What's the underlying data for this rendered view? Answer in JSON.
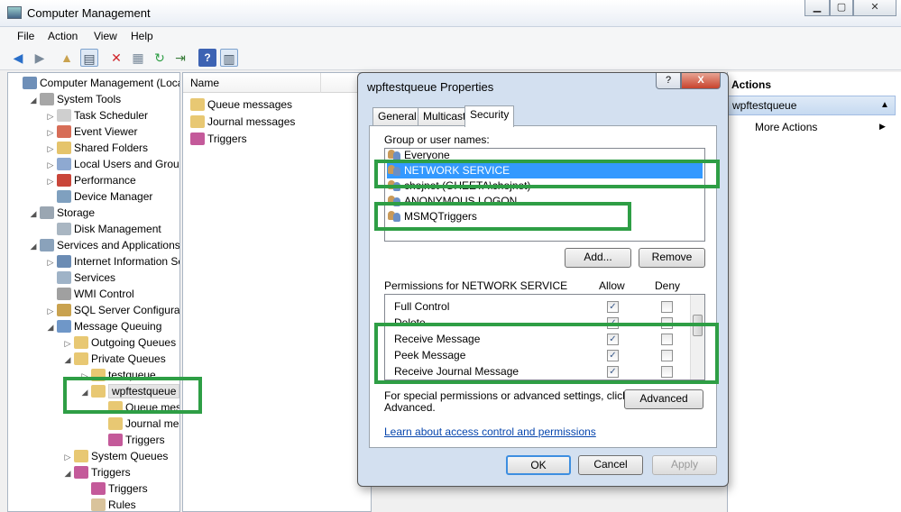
{
  "window": {
    "title": "Computer Management",
    "min": "▁",
    "max": "▢",
    "close": "✕"
  },
  "menu": [
    "File",
    "Action",
    "View",
    "Help"
  ],
  "tree": [
    {
      "label": "Computer Management (Local",
      "depth": 0,
      "arrow": "",
      "color": "#6e8fb8"
    },
    {
      "label": "System Tools",
      "depth": 1,
      "arrow": "◢",
      "color": "#a7a7a7"
    },
    {
      "label": "Task Scheduler",
      "depth": 2,
      "arrow": "▷",
      "color": "#cfcfcf"
    },
    {
      "label": "Event Viewer",
      "depth": 2,
      "arrow": "▷",
      "color": "#d76d57"
    },
    {
      "label": "Shared Folders",
      "depth": 2,
      "arrow": "▷",
      "color": "#e5c46c"
    },
    {
      "label": "Local Users and Groups",
      "depth": 2,
      "arrow": "▷",
      "color": "#8ea9d1"
    },
    {
      "label": "Performance",
      "depth": 2,
      "arrow": "▷",
      "color": "#c9463a"
    },
    {
      "label": "Device Manager",
      "depth": 2,
      "arrow": "",
      "color": "#7fa0bf"
    },
    {
      "label": "Storage",
      "depth": 1,
      "arrow": "◢",
      "color": "#9aa6b2"
    },
    {
      "label": "Disk Management",
      "depth": 2,
      "arrow": "",
      "color": "#a9b6c2"
    },
    {
      "label": "Services and Applications",
      "depth": 1,
      "arrow": "◢",
      "color": "#8aa2bb"
    },
    {
      "label": "Internet Information Ser",
      "depth": 2,
      "arrow": "▷",
      "color": "#6b8cb4"
    },
    {
      "label": "Services",
      "depth": 2,
      "arrow": "",
      "color": "#9fb3c7"
    },
    {
      "label": "WMI Control",
      "depth": 2,
      "arrow": "",
      "color": "#a0a0a0"
    },
    {
      "label": "SQL Server Configuratic",
      "depth": 2,
      "arrow": "▷",
      "color": "#c9a24f"
    },
    {
      "label": "Message Queuing",
      "depth": 2,
      "arrow": "◢",
      "color": "#6f97c8"
    },
    {
      "label": "Outgoing Queues",
      "depth": 3,
      "arrow": "▷",
      "color": "#e8c873"
    },
    {
      "label": "Private Queues",
      "depth": 3,
      "arrow": "◢",
      "color": "#e8c873"
    },
    {
      "label": "testqueue",
      "depth": 4,
      "arrow": "▷",
      "color": "#e8c873"
    },
    {
      "label": "wpftestqueue",
      "depth": 4,
      "arrow": "◢",
      "color": "#e8c873",
      "selected": true
    },
    {
      "label": "Queue mess",
      "depth": 5,
      "arrow": "",
      "color": "#e8c873"
    },
    {
      "label": "Journal mess",
      "depth": 5,
      "arrow": "",
      "color": "#e8c873"
    },
    {
      "label": "Triggers",
      "depth": 5,
      "arrow": "",
      "color": "#c45a9a"
    },
    {
      "label": "System Queues",
      "depth": 3,
      "arrow": "▷",
      "color": "#e8c873"
    },
    {
      "label": "Triggers",
      "depth": 3,
      "arrow": "◢",
      "color": "#c45a9a"
    },
    {
      "label": "Triggers",
      "depth": 4,
      "arrow": "",
      "color": "#c45a9a"
    },
    {
      "label": "Rules",
      "depth": 4,
      "arrow": "",
      "color": "#d9c39b"
    }
  ],
  "middle": {
    "column_name": "Name",
    "items": [
      "Queue messages",
      "Journal messages",
      "Triggers"
    ]
  },
  "actions": {
    "header": "Actions",
    "selected": "wpftestqueue",
    "more": "More Actions",
    "collapse_glyph": "▲",
    "more_glyph": "▶"
  },
  "dialog": {
    "title": "wpftestqueue Properties",
    "help": "?",
    "close": "X",
    "tabs": [
      "General",
      "Multicast",
      "Security"
    ],
    "group_label": "Group or user names:",
    "users": [
      {
        "name": "Everyone"
      },
      {
        "name": "NETWORK SERVICE",
        "selected": true
      },
      {
        "name": "chojnet (GHEETA\\chojnet)"
      },
      {
        "name": "ANONYMOUS LOGON"
      },
      {
        "name": "MSMQTriggers"
      }
    ],
    "add_button": "Add...",
    "remove_button": "Remove",
    "permissions_label": "Permissions for NETWORK SERVICE",
    "allow_col": "Allow",
    "deny_col": "Deny",
    "permissions": [
      {
        "name": "Full Control",
        "allow": true,
        "deny": false
      },
      {
        "name": "Delete",
        "allow": true,
        "deny": false
      },
      {
        "name": "Receive Message",
        "allow": true,
        "deny": false
      },
      {
        "name": "Peek Message",
        "allow": true,
        "deny": false
      },
      {
        "name": "Receive Journal Message",
        "allow": true,
        "deny": false
      }
    ],
    "special_text_1": "For special permissions or advanced settings, click",
    "special_text_2": "Advanced.",
    "advanced_button": "Advanced",
    "learn_link": "Learn about access control and permissions",
    "ok": "OK",
    "cancel": "Cancel",
    "apply": "Apply"
  },
  "highlight_color": "#2e9e45"
}
